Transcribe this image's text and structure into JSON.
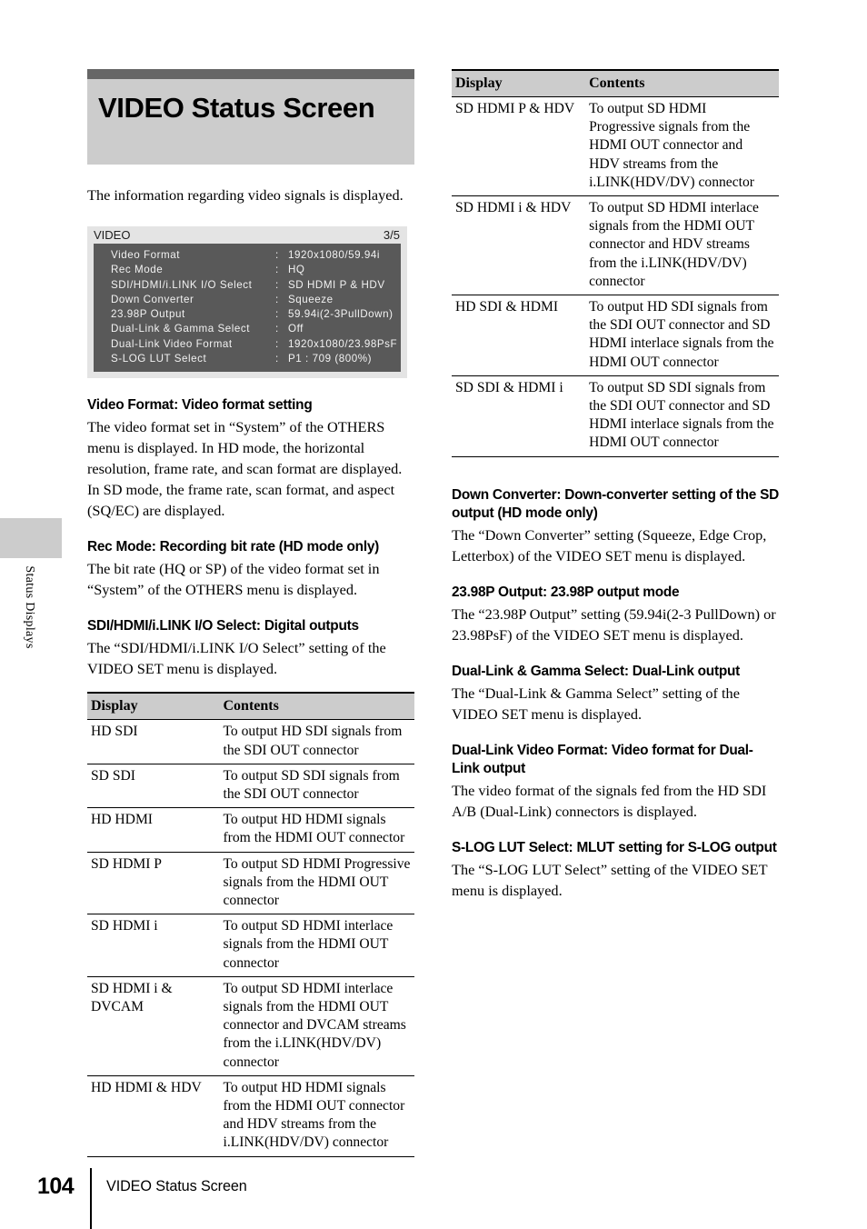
{
  "side_tab": {
    "label": "Status Displays"
  },
  "chapter": {
    "title": "VIDEO Status Screen"
  },
  "intro": {
    "text": "The information regarding video signals is displayed."
  },
  "status_screen": {
    "header_title": "VIDEO",
    "header_page": "3/5",
    "colon": ":",
    "rows": [
      {
        "label": "Video Format",
        "value": "1920x1080/59.94i"
      },
      {
        "label": "Rec Mode",
        "value": "HQ"
      },
      {
        "label": "SDI/HDMI/i.LINK I/O Select",
        "value": "SD HDMI P & HDV"
      },
      {
        "label": "Down Converter",
        "value": "Squeeze"
      },
      {
        "label": "23.98P Output",
        "value": "59.94i(2-3PullDown)"
      },
      {
        "label": "Dual-Link & Gamma Select",
        "value": "Off"
      },
      {
        "label": "Dual-Link Video Format",
        "value": "1920x1080/23.98PsF"
      },
      {
        "label": "S-LOG LUT Select",
        "value": "P1 : 709 (800%)"
      }
    ]
  },
  "sections": {
    "video_format": {
      "heading": "Video Format: Video format setting",
      "body": "The video format set in “System” of the OTHERS menu is displayed. In HD mode, the horizontal resolution, frame rate, and scan format are displayed. In SD mode, the frame rate, scan format, and aspect (SQ/EC) are displayed."
    },
    "rec_mode": {
      "heading": "Rec Mode: Recording bit rate (HD mode only)",
      "body": "The bit rate (HQ or SP) of the video format set in “System” of the OTHERS menu is displayed."
    },
    "io_select": {
      "heading": "SDI/HDMI/i.LINK I/O Select: Digital outputs",
      "body": "The “SDI/HDMI/i.LINK I/O Select” setting of the VIDEO SET menu is displayed."
    },
    "down_converter": {
      "heading": "Down Converter: Down-converter setting of the SD output (HD mode only)",
      "body": "The “Down Converter” setting (Squeeze, Edge Crop, Letterbox) of the VIDEO SET menu is displayed."
    },
    "output_2398p": {
      "heading": "23.98P Output: 23.98P output mode",
      "body": "The “23.98P Output” setting (59.94i(2-3 PullDown) or 23.98PsF) of the VIDEO SET menu is displayed."
    },
    "dual_link_gamma": {
      "heading": "Dual-Link & Gamma Select: Dual-Link output",
      "body": "The “Dual-Link & Gamma Select” setting of the VIDEO SET menu is displayed."
    },
    "dual_link_format": {
      "heading": "Dual-Link Video Format: Video format for Dual-Link output",
      "body": "The video format of the signals fed from the HD SDI A/B (Dual-Link) connectors is displayed."
    },
    "slog_lut": {
      "heading": "S-LOG LUT Select: MLUT setting for S-LOG output",
      "body": "The “S-LOG LUT Select” setting of the VIDEO SET menu is displayed."
    }
  },
  "table_left": {
    "headers": [
      "Display",
      "Contents"
    ],
    "rows": [
      {
        "display": "HD SDI",
        "contents": "To output HD SDI signals from the SDI OUT connector"
      },
      {
        "display": "SD  SDI",
        "contents": "To output SD SDI signals from the SDI OUT connector"
      },
      {
        "display": "HD HDMI",
        "contents": "To output HD HDMI signals from the HDMI OUT connector"
      },
      {
        "display": "SD HDMI P",
        "contents": "To output SD HDMI Progressive signals from the HDMI OUT connector"
      },
      {
        "display": "SD HDMI i",
        "contents": "To output SD HDMI interlace signals from the HDMI OUT connector"
      },
      {
        "display": "SD HDMI i & DVCAM",
        "contents": "To output SD HDMI interlace signals from the HDMI OUT connector and DVCAM streams from the i.LINK(HDV/DV) connector"
      },
      {
        "display": "HD HDMI & HDV",
        "contents": "To output HD HDMI signals from the HDMI OUT connector and HDV streams from the i.LINK(HDV/DV) connector"
      }
    ]
  },
  "table_right": {
    "headers": [
      "Display",
      "Contents"
    ],
    "rows": [
      {
        "display": "SD HDMI P & HDV",
        "contents": "To output SD HDMI Progressive signals from the HDMI OUT connector and HDV streams from the i.LINK(HDV/DV) connector"
      },
      {
        "display": "SD HDMI i & HDV",
        "contents": "To output SD HDMI interlace signals from the HDMI OUT connector and HDV streams from the i.LINK(HDV/DV) connector"
      },
      {
        "display": "HD SDI & HDMI",
        "contents": "To output HD SDI signals from the SDI OUT connector and SD HDMI interlace signals from the HDMI OUT connector"
      },
      {
        "display": "SD SDI & HDMI i",
        "contents": "To output SD SDI signals from the SDI OUT connector and SD HDMI interlace signals from the HDMI OUT connector"
      }
    ]
  },
  "footer": {
    "page_number": "104",
    "title": "VIDEO Status Screen"
  }
}
